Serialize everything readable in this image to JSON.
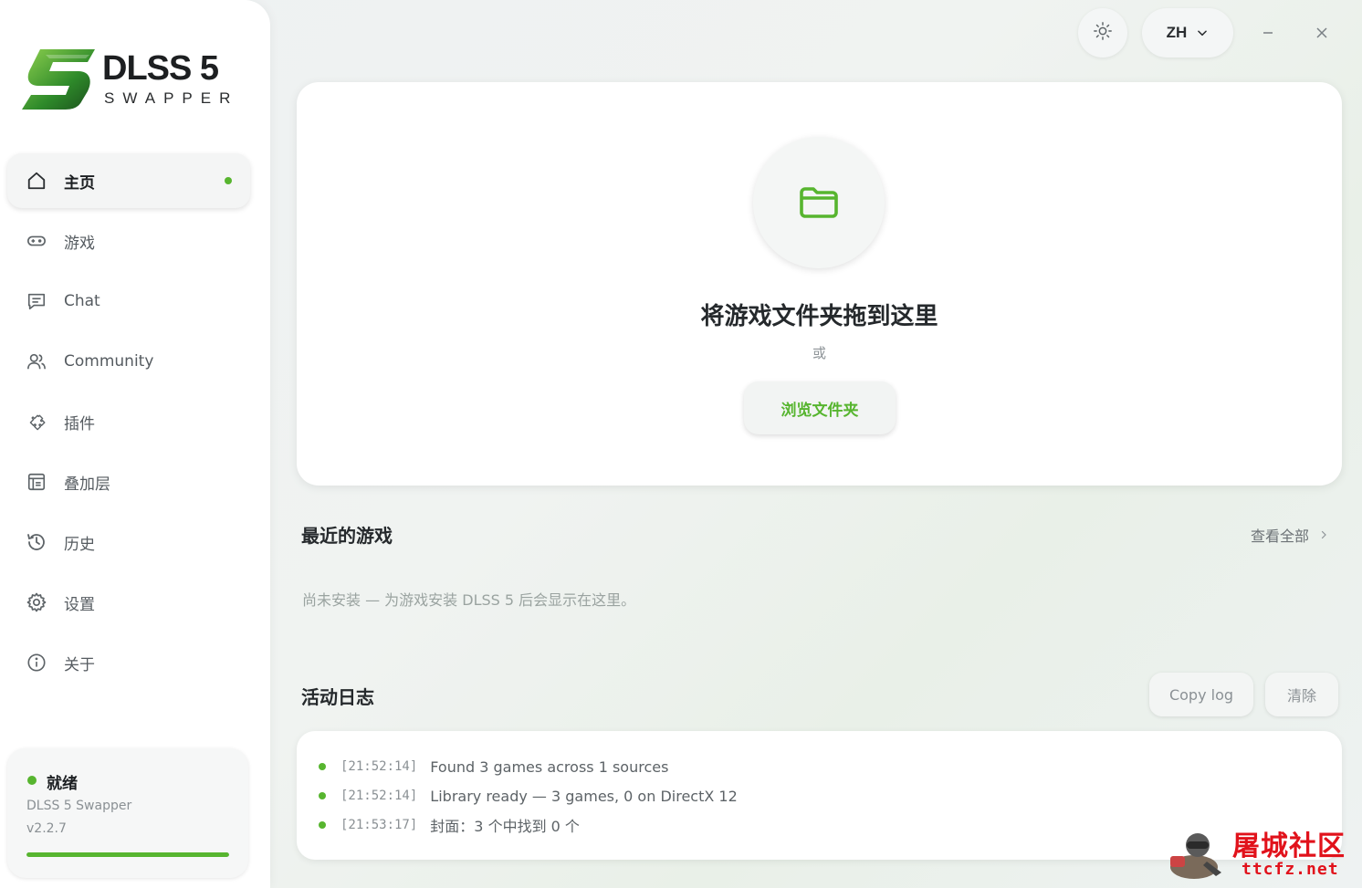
{
  "brand": {
    "name": "DLSS 5",
    "sub": "SWAPPER",
    "accent": "#57b52f"
  },
  "sidebar": {
    "items": [
      {
        "label": "主页",
        "icon": "home-icon",
        "active": true
      },
      {
        "label": "游戏",
        "icon": "gamepad-icon"
      },
      {
        "label": "Chat",
        "icon": "chat-icon"
      },
      {
        "label": "Community",
        "icon": "users-icon"
      },
      {
        "label": "插件",
        "icon": "puzzle-icon"
      },
      {
        "label": "叠加层",
        "icon": "overlay-icon"
      },
      {
        "label": "历史",
        "icon": "history-icon"
      },
      {
        "label": "设置",
        "icon": "gear-icon"
      },
      {
        "label": "关于",
        "icon": "info-icon"
      }
    ],
    "status": {
      "title": "就绪",
      "app": "DLSS 5 Swapper",
      "version": "v2.2.7",
      "progress": 1.0
    }
  },
  "topbar": {
    "language": "ZH",
    "theme_icon": "sun-icon"
  },
  "drop": {
    "title": "将游戏文件夹拖到这里",
    "or": "或",
    "browse_label": "浏览文件夹",
    "icon": "folder-icon"
  },
  "recent": {
    "title": "最近的游戏",
    "view_all": "查看全部",
    "empty_text": "尚未安装 — 为游戏安装 DLSS 5 后会显示在这里。"
  },
  "activity": {
    "title": "活动日志",
    "copy_label": "Copy log",
    "clear_label": "清除",
    "entries": [
      {
        "time": "[21:52:14]",
        "message": "Found 3 games across 1 sources"
      },
      {
        "time": "[21:52:14]",
        "message": "Library ready — 3 games, 0 on DirectX 12"
      },
      {
        "time": "[21:53:17]",
        "message": "封面：3 个中找到 0 个"
      }
    ]
  },
  "watermark": {
    "title": "屠城社区",
    "url": "ttcfz.net"
  }
}
